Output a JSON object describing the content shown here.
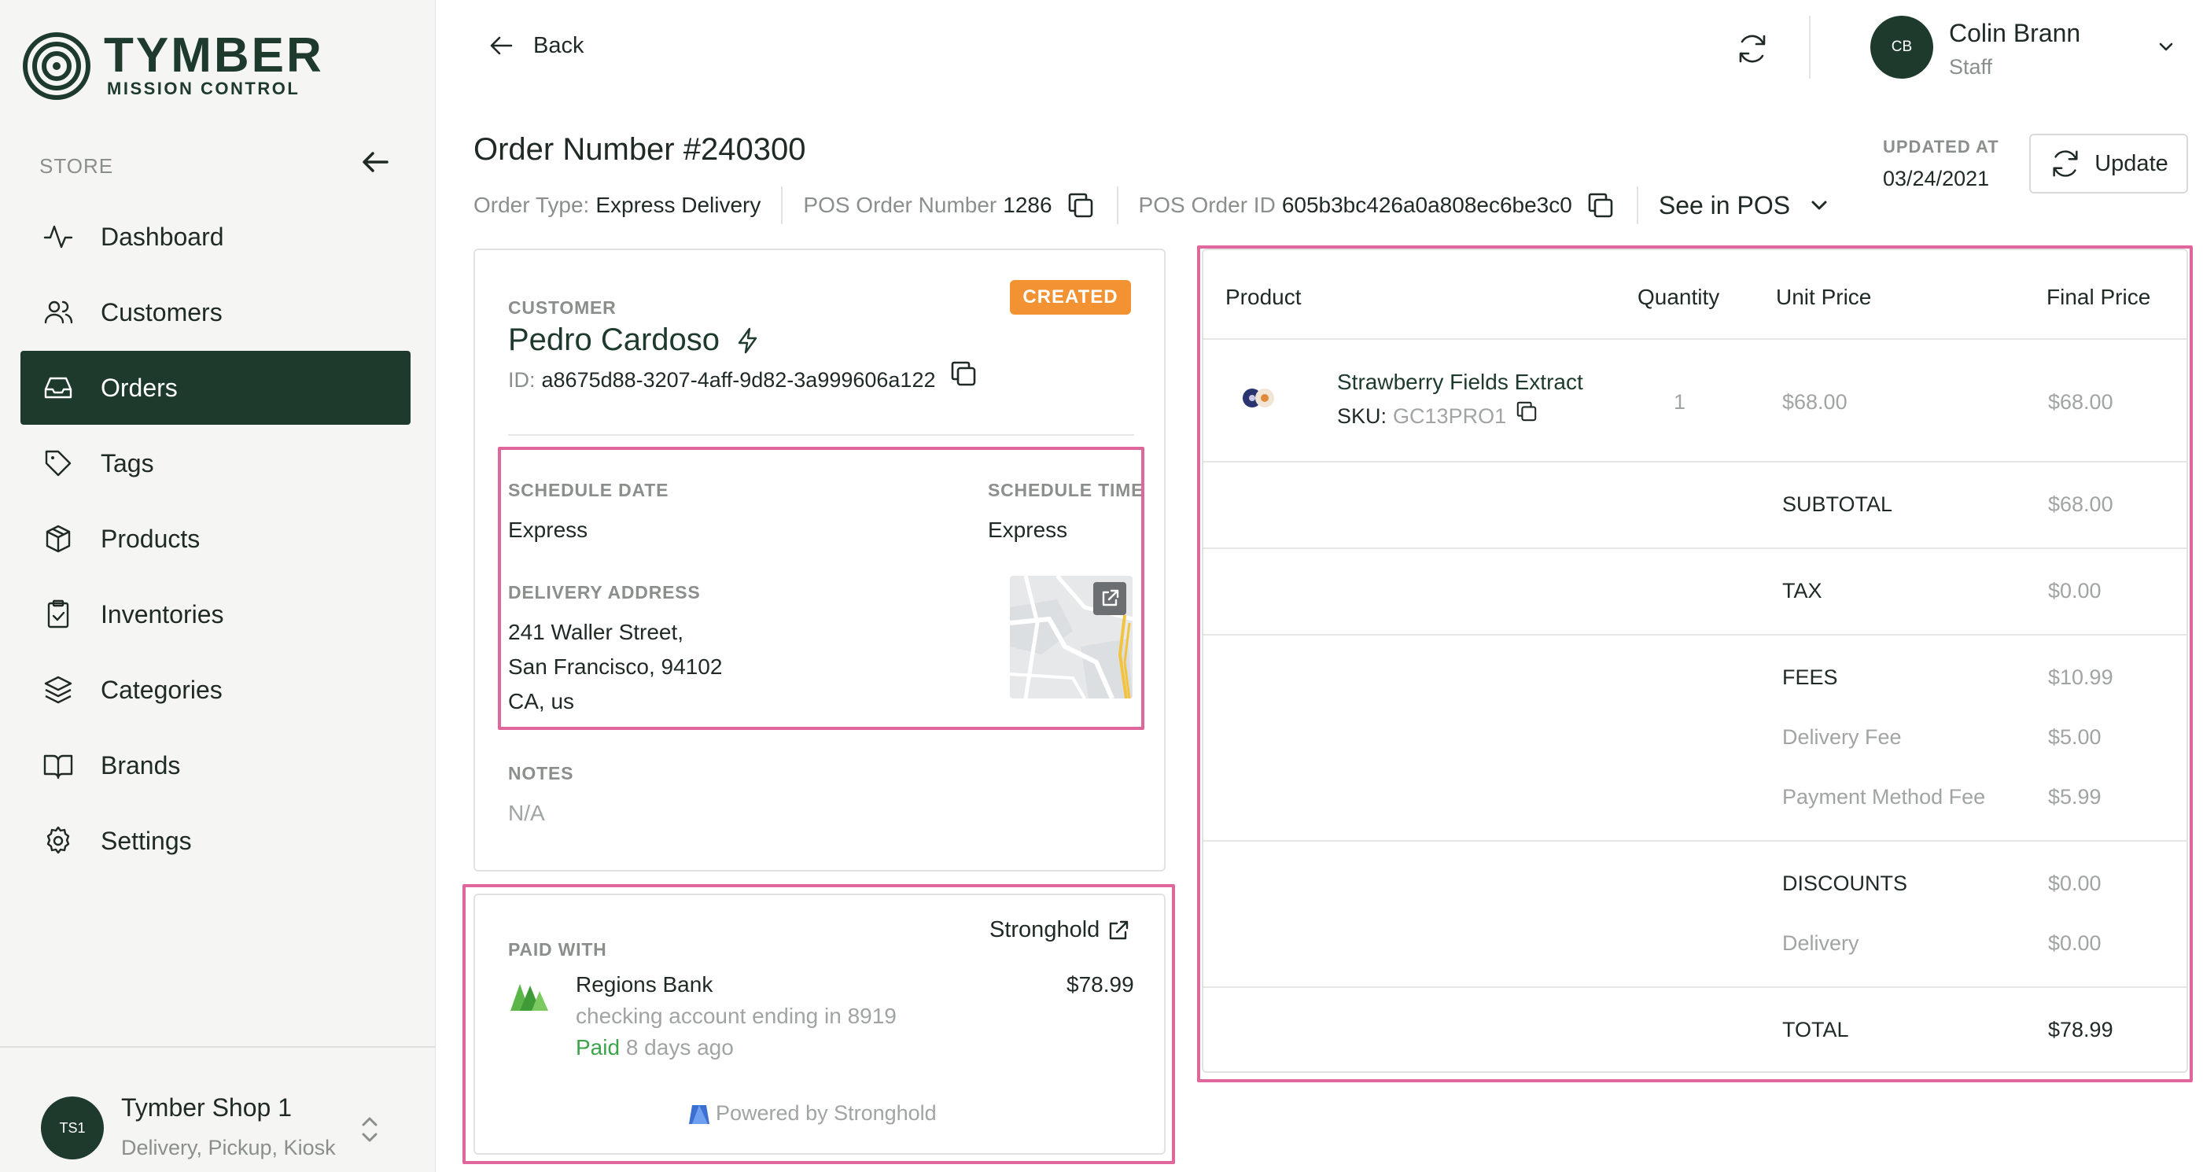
{
  "brand": {
    "title": "TYMBER",
    "subtitle": "MISSION CONTROL"
  },
  "sidebar": {
    "section_label": "STORE",
    "items": [
      {
        "label": "Dashboard",
        "icon": "activity-icon",
        "active": false
      },
      {
        "label": "Customers",
        "icon": "users-icon",
        "active": false
      },
      {
        "label": "Orders",
        "icon": "inbox-icon",
        "active": true
      },
      {
        "label": "Tags",
        "icon": "tag-icon",
        "active": false
      },
      {
        "label": "Products",
        "icon": "box-icon",
        "active": false
      },
      {
        "label": "Inventories",
        "icon": "clipboard-check-icon",
        "active": false
      },
      {
        "label": "Categories",
        "icon": "layers-icon",
        "active": false
      },
      {
        "label": "Brands",
        "icon": "book-open-icon",
        "active": false
      },
      {
        "label": "Settings",
        "icon": "gear-icon",
        "active": false
      }
    ],
    "shop": {
      "initials": "TS1",
      "name": "Tymber Shop 1",
      "types": "Delivery, Pickup, Kiosk"
    }
  },
  "topbar": {
    "back_label": "Back",
    "user": {
      "initials": "CB",
      "name": "Colin Brann",
      "role": "Staff"
    }
  },
  "order": {
    "title": "Order Number #240300",
    "type_label": "Order Type:",
    "type_value": "Express Delivery",
    "pos_number_label": "POS Order Number",
    "pos_number_value": "1286",
    "pos_id_label": "POS Order ID",
    "pos_id_value": "605b3bc426a0a808ec6be3c0",
    "see_in_pos": "See in POS",
    "updated_label": "UPDATED AT",
    "updated_value": "03/24/2021",
    "update_button": "Update",
    "status": "CREATED"
  },
  "customer": {
    "section_label": "CUSTOMER",
    "name": "Pedro Cardoso",
    "id_label": "ID:",
    "id_value": "a8675d88-3207-4aff-9d82-3a999606a122",
    "schedule_date_label": "SCHEDULE DATE",
    "schedule_date_value": "Express",
    "schedule_time_label": "SCHEDULE TIME",
    "schedule_time_value": "Express",
    "address_label": "DELIVERY ADDRESS",
    "address_line1": "241 Waller Street,",
    "address_line2": "San Francisco, 94102",
    "address_line3": "CA, us",
    "notes_label": "NOTES",
    "notes_value": "N/A"
  },
  "payment": {
    "section_label": "PAID WITH",
    "provider_link": "Stronghold",
    "bank_name": "Regions Bank",
    "account_desc": "checking account ending in 8919",
    "amount": "$78.99",
    "status": "Paid",
    "status_time": "8 days ago",
    "powered_by": "Powered by Stronghold"
  },
  "products_table": {
    "headers": {
      "product": "Product",
      "quantity": "Quantity",
      "unit_price": "Unit Price",
      "final_price": "Final Price"
    },
    "items": [
      {
        "name": "Strawberry Fields Extract",
        "sku_label": "SKU:",
        "sku": "GC13PRO1",
        "quantity": "1",
        "unit_price": "$68.00",
        "final_price": "$68.00"
      }
    ],
    "summary": {
      "subtotal_label": "SUBTOTAL",
      "subtotal": "$68.00",
      "tax_label": "TAX",
      "tax": "$0.00",
      "fees_label": "FEES",
      "fees": "$10.99",
      "delivery_fee_label": "Delivery Fee",
      "delivery_fee": "$5.00",
      "payment_fee_label": "Payment Method Fee",
      "payment_fee": "$5.99",
      "discounts_label": "DISCOUNTS",
      "discounts": "$0.00",
      "delivery_discount_label": "Delivery",
      "delivery_discount": "$0.00",
      "total_label": "TOTAL",
      "total": "$78.99"
    }
  },
  "colors": {
    "brand_dark_green": "#1d3a2d",
    "status_created": "#f39233",
    "paid_green": "#3da34b",
    "highlight_pink": "#e0679b"
  }
}
